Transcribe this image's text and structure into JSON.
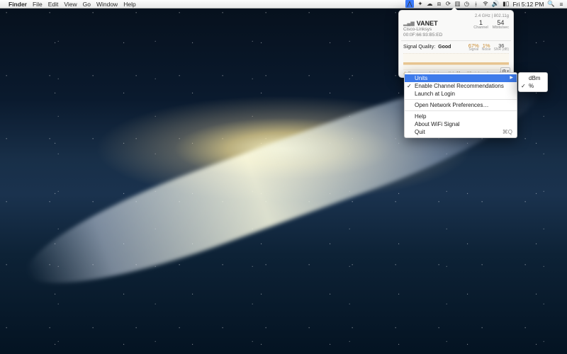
{
  "menubar": {
    "app": "Finder",
    "items": [
      "File",
      "Edit",
      "View",
      "Go",
      "Window",
      "Help"
    ],
    "clock": "Fri 5:12 PM"
  },
  "popover": {
    "ssid": "VANET",
    "vendor": "Cisco-Linksys",
    "mac": "00:0F:66:93:B5:ED",
    "band": "2.4 GHz  |  802.11g",
    "channel": {
      "value": "1",
      "label": "Channel"
    },
    "rate": {
      "value": "54",
      "label": "Mbits/sec"
    },
    "quality_label": "Signal Quality:",
    "quality_value": "Good",
    "signal": {
      "value": "67%",
      "label": "Signal"
    },
    "noise": {
      "value": "1%",
      "label": "Noise"
    },
    "snr": {
      "value": "36",
      "label": "SNR (dB)"
    },
    "hint_pre": "Recommended channel(s): ",
    "hint_ch": "11",
    "hint_post": " — What does it mean?"
  },
  "menu": {
    "units": "Units",
    "enable": "Enable Channel Recommendations",
    "launch": "Launch at Login",
    "prefs": "Open Network Preferences…",
    "help": "Help",
    "about": "About WiFi Signal",
    "quit": "Quit",
    "quit_key": "⌘Q"
  },
  "submenu": {
    "dbm": "dBm",
    "pct": "%"
  }
}
